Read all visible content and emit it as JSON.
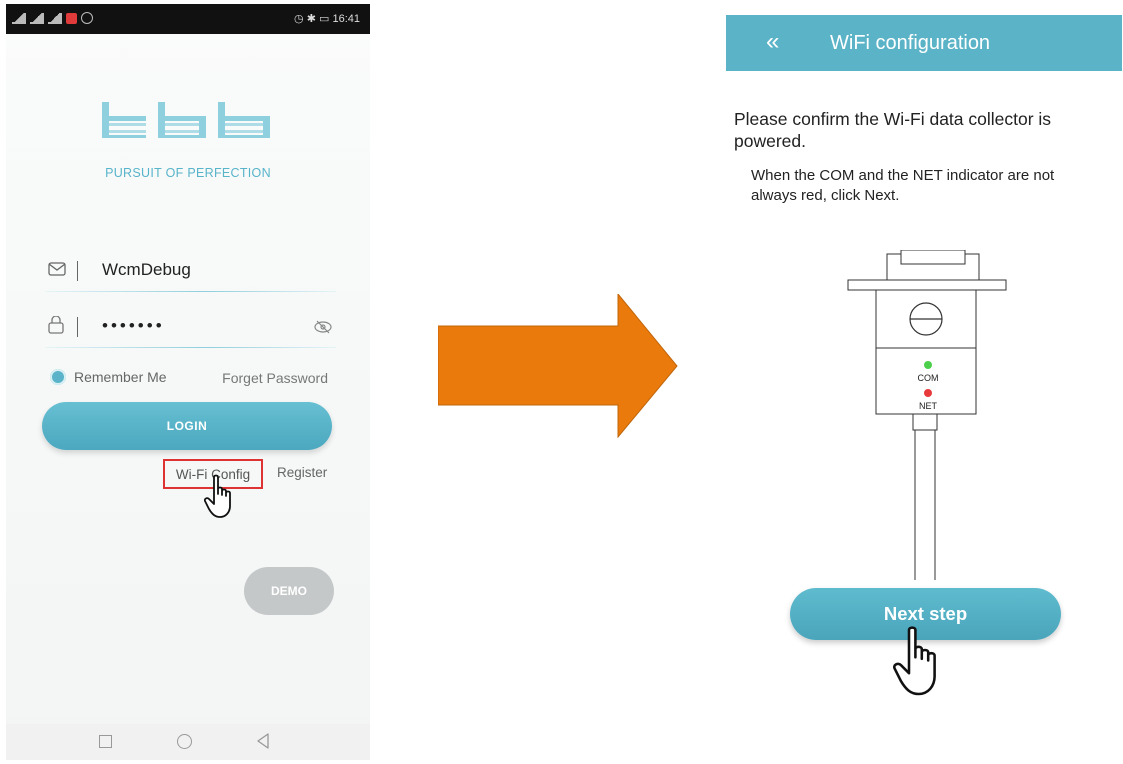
{
  "left_screen": {
    "status_bar": {
      "time": "16:41"
    },
    "tagline": "PURSUIT OF PERFECTION",
    "username": {
      "value": "WcmDebug"
    },
    "password": {
      "masked_value": "•••••••"
    },
    "remember_label": "Remember Me",
    "forget_label": "Forget Password",
    "login_label": "LOGIN",
    "wifi_config_label": "Wi-Fi Config",
    "register_label": "Register",
    "demo_label": "DEMO"
  },
  "right_screen": {
    "header": {
      "back_icon": "«",
      "title": "WiFi configuration"
    },
    "instruction_title": "Please confirm the Wi-Fi data collector is powered.",
    "instruction_sub": "When the COM and the NET indicator are not always red, click Next.",
    "device": {
      "com_label": "COM",
      "net_label": "NET",
      "com_color": "#4cd04c",
      "net_color": "#e83a3a"
    },
    "next_label": "Next step"
  },
  "colors": {
    "accent": "#5bb3c7",
    "arrow": "#ea7a0c",
    "highlight_box": "#dd3333",
    "demo_button": "#c5c8c9"
  }
}
